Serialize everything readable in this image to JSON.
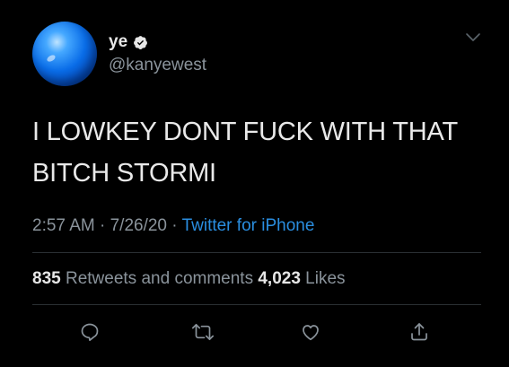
{
  "tweet": {
    "display_name": "ye",
    "handle": "@kanyewest",
    "verified_icon": "verified-badge-icon",
    "text_line1": "I LOWKEY DONT FUCK WITH THAT",
    "text_line2": "BITCH STORMI",
    "time": "2:57 AM",
    "sep1": " · ",
    "date": "7/26/20",
    "sep2": " · ",
    "source": "Twitter for iPhone",
    "retweets_count": "835",
    "retweets_label": " Retweets and comments ",
    "likes_count": "4,023",
    "likes_label": " Likes"
  },
  "actions": {
    "icons": [
      "reply-icon",
      "retweet-icon",
      "like-icon",
      "share-icon"
    ]
  },
  "colors": {
    "background": "#000000",
    "link": "#2a8ee0",
    "muted": "#8a939b",
    "text": "#e9e9e9"
  }
}
